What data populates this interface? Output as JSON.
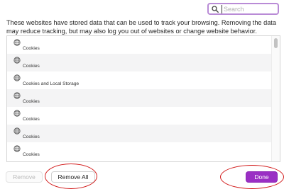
{
  "search": {
    "placeholder": "Search",
    "value": ""
  },
  "description": "These websites have stored data that can be used to track your browsing. Removing the data may reduce tracking, but may also log you out of websites or change website behavior.",
  "website_list": {
    "items": [
      {
        "icon": "globe-icon",
        "label": "Cookies"
      },
      {
        "icon": "globe-icon",
        "label": "Cookies"
      },
      {
        "icon": "globe-icon",
        "label": "Cookies and Local Storage"
      },
      {
        "icon": "globe-icon",
        "label": "Cookies"
      },
      {
        "icon": "globe-icon",
        "label": "Cookies"
      },
      {
        "icon": "globe-icon",
        "label": "Cookies"
      },
      {
        "icon": "globe-icon",
        "label": "Cookies"
      }
    ]
  },
  "buttons": {
    "remove_label": "Remove",
    "remove_all_label": "Remove All",
    "done_label": "Done"
  },
  "colors": {
    "accent": "#9a2fc4",
    "search_focus_ring": "#b98bd6",
    "annotation": "#d21a1a"
  }
}
